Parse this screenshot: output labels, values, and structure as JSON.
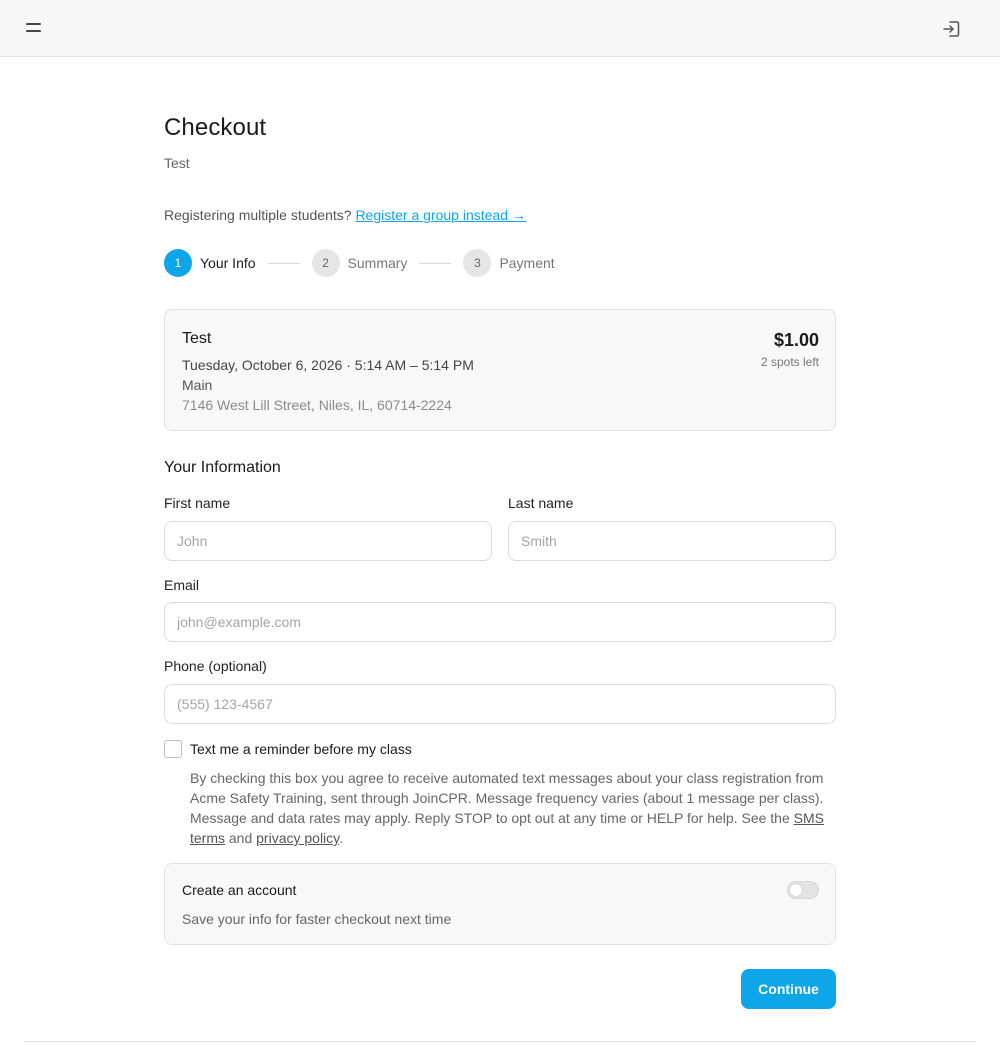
{
  "header": {
    "menu_icon": "hamburger-menu-icon",
    "login_icon": "sign-in-icon"
  },
  "page": {
    "title": "Checkout",
    "subtitle": "Test"
  },
  "group_register": {
    "prompt": "Registering multiple students? ",
    "link": "Register a group instead →"
  },
  "steps": [
    {
      "number": "1",
      "label": "Your Info",
      "active": true
    },
    {
      "number": "2",
      "label": "Summary",
      "active": false
    },
    {
      "number": "3",
      "label": "Payment",
      "active": false
    }
  ],
  "class_info": {
    "name": "Test",
    "date": "Tuesday, October 6, 2026",
    "separator": " · ",
    "time": "5:14 AM – 5:14 PM",
    "location": "Main",
    "address": "7146 West Lill Street, Niles, IL, 60714-2224",
    "price": "$1.00",
    "spots": "2 spots left"
  },
  "form": {
    "section_title": "Your Information",
    "first_name": {
      "label": "First name",
      "placeholder": "John",
      "value": ""
    },
    "last_name": {
      "label": "Last name",
      "placeholder": "Smith",
      "value": ""
    },
    "email": {
      "label": "Email",
      "placeholder": "john@example.com",
      "value": ""
    },
    "phone": {
      "label": "Phone (optional)",
      "placeholder": "(555) 123-4567",
      "value": ""
    }
  },
  "reminder": {
    "label": "Text me a reminder before my class",
    "checked": false,
    "consent_text": "By checking this box you agree to receive automated text messages about your class registration from Acme Safety Training, sent through JoinCPR. Message frequency varies (about 1 message per class). Message and data rates may apply. Reply STOP to opt out at any time or HELP for help. See the ",
    "sms_terms_link": "SMS terms",
    "and_text": " and ",
    "privacy_link": "privacy policy",
    "end_text": "."
  },
  "account": {
    "title": "Create an account",
    "description": "Save your info for faster checkout next time",
    "enabled": false
  },
  "actions": {
    "continue_label": "Continue"
  },
  "colors": {
    "accent": "#0ea5e9",
    "card_bg": "#f8f8f8"
  }
}
